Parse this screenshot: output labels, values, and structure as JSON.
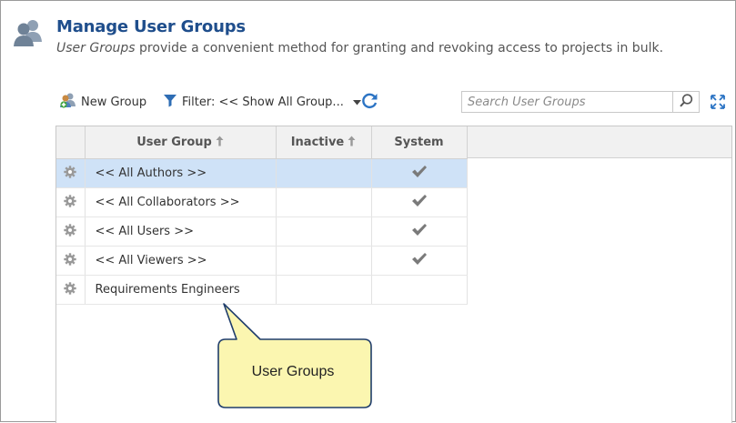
{
  "header": {
    "title": "Manage User Groups",
    "subtitle_italic": "User Groups",
    "subtitle_rest": " provide a convenient method for granting and revoking access to projects in bulk."
  },
  "toolbar": {
    "new_group_label": "New Group",
    "filter_label": "Filter: << Show All Group...",
    "search_placeholder": "Search User Groups"
  },
  "table": {
    "columns": [
      "User Group",
      "Inactive",
      "System"
    ],
    "rows": [
      {
        "name": "<< All Authors >>",
        "inactive": false,
        "system": true,
        "selected": true
      },
      {
        "name": "<< All Collaborators >>",
        "inactive": false,
        "system": true,
        "selected": false
      },
      {
        "name": "<< All Users >>",
        "inactive": false,
        "system": true,
        "selected": false
      },
      {
        "name": "<< All Viewers >>",
        "inactive": false,
        "system": true,
        "selected": false
      },
      {
        "name": "Requirements Engineers",
        "inactive": false,
        "system": false,
        "selected": false
      }
    ]
  },
  "callout": {
    "text": "User Groups"
  },
  "icons": {
    "header": "user-group-icon",
    "new_group": "add-user-group-icon",
    "filter": "filter-icon",
    "refresh": "refresh-icon",
    "search": "search-icon",
    "expand": "expand-icon",
    "row_action": "gear-icon",
    "system_check": "checkmark-icon",
    "sort": "sort-up-arrow-icon"
  },
  "colors": {
    "title": "#1f4e8c",
    "selected_row": "#cfe2f7",
    "callout_fill": "#fbf6b0",
    "callout_border": "#1f3d6b",
    "refresh": "#2c74c4"
  }
}
